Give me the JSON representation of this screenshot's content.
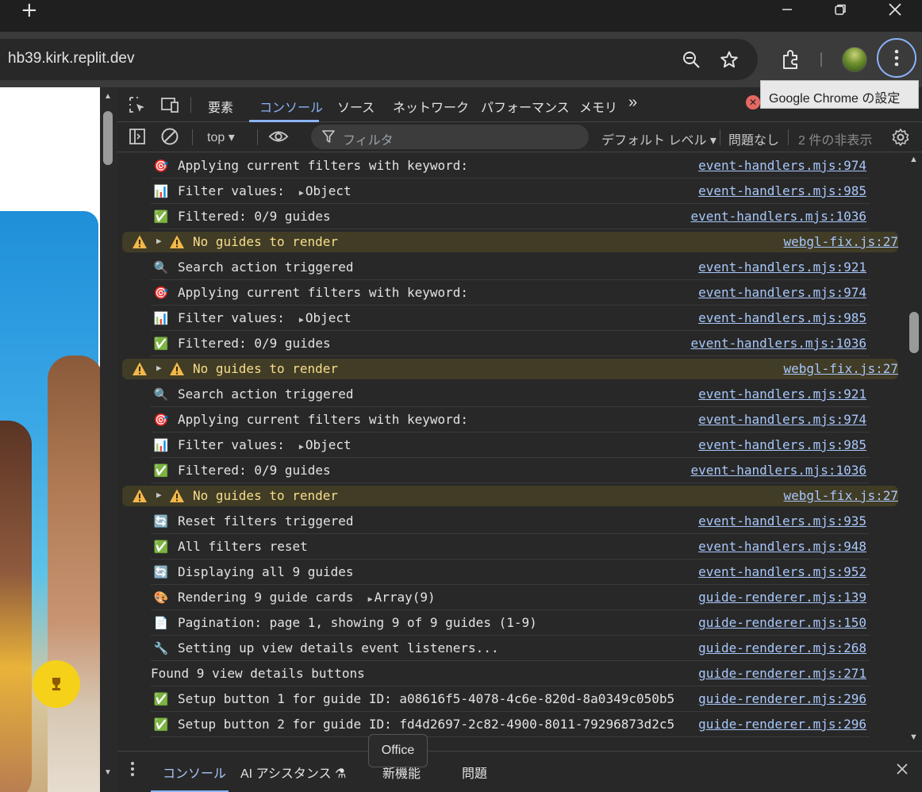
{
  "browser": {
    "new_tab_label": "+",
    "url": "hb39.kirk.replit.dev",
    "tooltip": "Google Chrome の設定"
  },
  "devtools": {
    "tabs": [
      "要素",
      "コンソール",
      "ソース",
      "ネットワーク",
      "パフォーマンス",
      "メモリ"
    ],
    "more_tabs": "»",
    "error_count": "✕",
    "toolbar": {
      "context": "top ▾",
      "filter_placeholder": "フィルタ",
      "level": "デフォルト レベル ▾",
      "issues": "問題なし",
      "hidden": "2 件の非表示"
    },
    "console_rows": [
      {
        "emoji": "🎯",
        "msg": "Applying current filters with keyword:",
        "src": "event-handlers.mjs:974"
      },
      {
        "emoji": "📊",
        "msg": "Filter values:",
        "obj": "Object",
        "src": "event-handlers.mjs:985"
      },
      {
        "emoji": "✅",
        "msg": "Filtered: 0/9 guides",
        "src": "event-handlers.mjs:1036"
      },
      {
        "warn": true,
        "msg": "No guides to render",
        "src": "webgl-fix.js:27"
      },
      {
        "emoji": "🔍",
        "msg": "Search action triggered",
        "src": "event-handlers.mjs:921"
      },
      {
        "emoji": "🎯",
        "msg": "Applying current filters with keyword:",
        "src": "event-handlers.mjs:974"
      },
      {
        "emoji": "📊",
        "msg": "Filter values:",
        "obj": "Object",
        "src": "event-handlers.mjs:985"
      },
      {
        "emoji": "✅",
        "msg": "Filtered: 0/9 guides",
        "src": "event-handlers.mjs:1036"
      },
      {
        "warn": true,
        "msg": "No guides to render",
        "src": "webgl-fix.js:27"
      },
      {
        "emoji": "🔍",
        "msg": "Search action triggered",
        "src": "event-handlers.mjs:921"
      },
      {
        "emoji": "🎯",
        "msg": "Applying current filters with keyword:",
        "src": "event-handlers.mjs:974"
      },
      {
        "emoji": "📊",
        "msg": "Filter values:",
        "obj": "Object",
        "src": "event-handlers.mjs:985"
      },
      {
        "emoji": "✅",
        "msg": "Filtered: 0/9 guides",
        "src": "event-handlers.mjs:1036"
      },
      {
        "warn": true,
        "msg": "No guides to render",
        "src": "webgl-fix.js:27"
      },
      {
        "emoji": "🔄",
        "msg": "Reset filters triggered",
        "src": "event-handlers.mjs:935"
      },
      {
        "emoji": "✅",
        "msg": "All filters reset",
        "src": "event-handlers.mjs:948"
      },
      {
        "emoji": "🔄",
        "msg": "Displaying all 9 guides",
        "src": "event-handlers.mjs:952"
      },
      {
        "emoji": "🎨",
        "msg": "Rendering 9 guide cards",
        "obj": "Array(9)",
        "src": "guide-renderer.mjs:139"
      },
      {
        "emoji": "📄",
        "msg": "Pagination: page 1, showing 9 of 9 guides (1-9)",
        "src": "guide-renderer.mjs:150"
      },
      {
        "emoji": "🔧",
        "msg": "Setting up view details event listeners...",
        "src": "guide-renderer.mjs:268"
      },
      {
        "emoji": "",
        "msg": "Found 9 view details buttons",
        "src": "guide-renderer.mjs:271"
      },
      {
        "emoji": "✅",
        "msg": "Setup button 1 for guide ID: a08616f5-4078-4c6e-820d-8a0349c050b5",
        "src": "guide-renderer.mjs:296"
      },
      {
        "emoji": "✅",
        "msg": "Setup button 2 for guide ID: fd4d2697-2c82-4900-8011-79296873d2c5",
        "src": "guide-renderer.mjs:296"
      }
    ],
    "drawer": {
      "tabs": [
        "コンソール",
        "AI アシスタンス ⚗",
        "新機能",
        "問題"
      ],
      "tooltip": "Office"
    }
  },
  "colors": {
    "accent": "#8ab4f8",
    "link": "#a8c7fa",
    "warn_bg": "#413c26",
    "warn_text": "#f7de8b"
  }
}
